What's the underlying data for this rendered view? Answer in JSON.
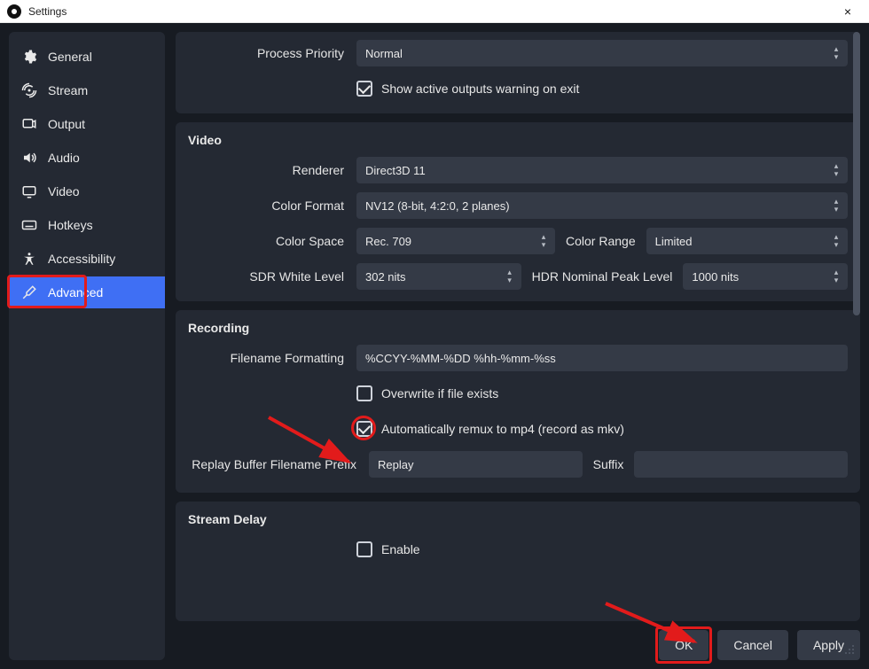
{
  "window": {
    "title": "Settings",
    "close_icon": "×"
  },
  "sidebar": {
    "items": [
      {
        "label": "General"
      },
      {
        "label": "Stream"
      },
      {
        "label": "Output"
      },
      {
        "label": "Audio"
      },
      {
        "label": "Video"
      },
      {
        "label": "Hotkeys"
      },
      {
        "label": "Accessibility"
      },
      {
        "label": "Advanced"
      }
    ]
  },
  "general": {
    "process_priority_label": "Process Priority",
    "process_priority_value": "Normal",
    "show_active_outputs_label": "Show active outputs warning on exit"
  },
  "video": {
    "title": "Video",
    "renderer_label": "Renderer",
    "renderer_value": "Direct3D 11",
    "color_format_label": "Color Format",
    "color_format_value": "NV12 (8-bit, 4:2:0, 2 planes)",
    "color_space_label": "Color Space",
    "color_space_value": "Rec. 709",
    "color_range_label": "Color Range",
    "color_range_value": "Limited",
    "sdr_white_label": "SDR White Level",
    "sdr_white_value": "302 nits",
    "hdr_peak_label": "HDR Nominal Peak Level",
    "hdr_peak_value": "1000 nits"
  },
  "recording": {
    "title": "Recording",
    "filename_fmt_label": "Filename Formatting",
    "filename_fmt_value": "%CCYY-%MM-%DD %hh-%mm-%ss",
    "overwrite_label": "Overwrite if file exists",
    "auto_remux_label": "Automatically remux to mp4 (record as mkv)",
    "replay_prefix_label": "Replay Buffer Filename Prefix",
    "replay_prefix_value": "Replay",
    "suffix_label": "Suffix",
    "suffix_value": ""
  },
  "stream_delay": {
    "title": "Stream Delay",
    "enable_label": "Enable"
  },
  "buttons": {
    "ok": "OK",
    "cancel": "Cancel",
    "apply": "Apply"
  },
  "colors": {
    "accent": "#3f6ff4",
    "danger": "#e21b1b"
  }
}
